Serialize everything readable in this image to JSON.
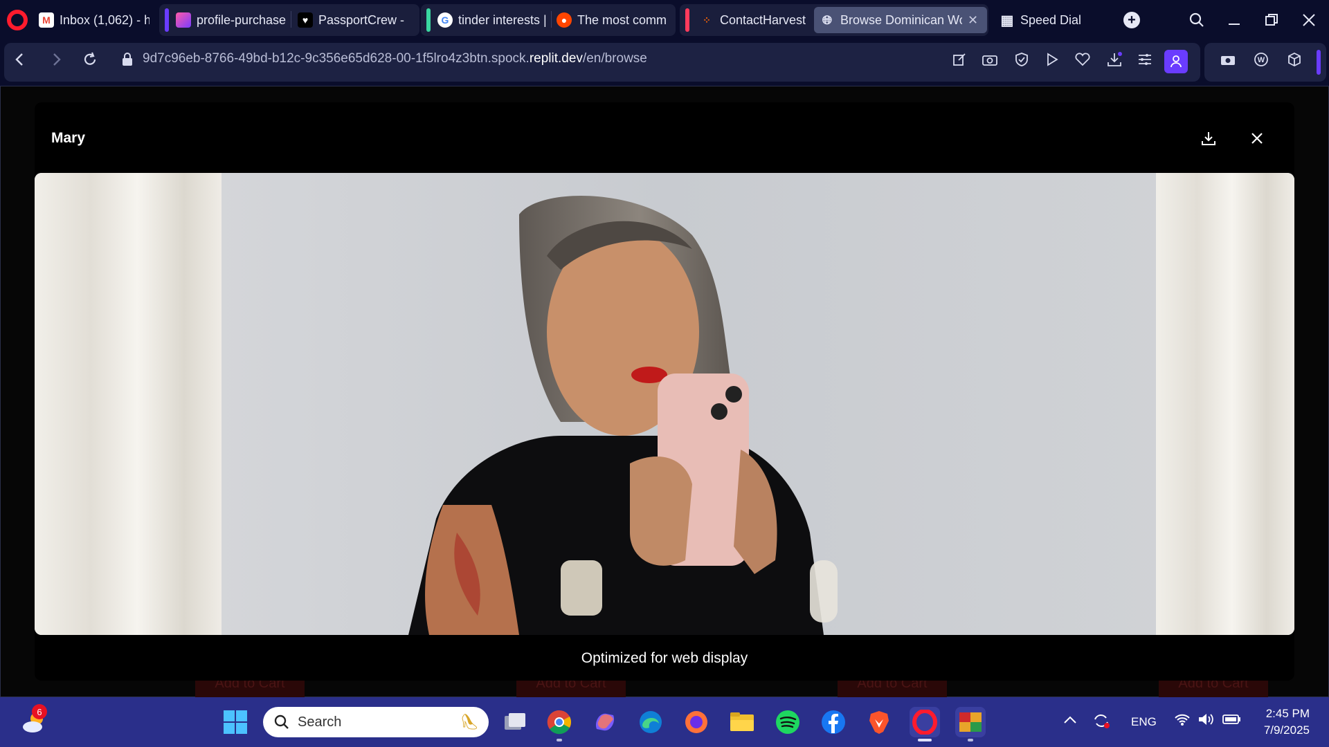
{
  "browser": {
    "tabs": [
      {
        "label": "Inbox (1,062) - h",
        "icon": "gmail-icon"
      },
      {
        "label": "profile-purchase",
        "icon": "heart-app-icon"
      },
      {
        "label": "PassportCrew - I",
        "icon": "heart-icon"
      },
      {
        "label": "tinder interests |",
        "icon": "google-icon"
      },
      {
        "label": "The most comm",
        "icon": "reddit-icon"
      },
      {
        "label": "ContactHarvest",
        "icon": "replit-icon"
      },
      {
        "label": "Browse Dominican Wo",
        "icon": "globe-icon",
        "active": true
      },
      {
        "label": "Speed Dial",
        "icon": "speed-dial-icon"
      }
    ],
    "address": {
      "prefix": "9d7c96eb-8766-49bd-b12c-9c356e65d628-00-1f5lro4z3btn.spock.",
      "host": "replit.dev",
      "path": "/en/browse"
    }
  },
  "modal": {
    "title": "Mary",
    "caption": "Optimized for web display"
  },
  "background": {
    "cart_label": "Add to Cart"
  },
  "taskbar": {
    "search_placeholder": "Search",
    "weather_badge": "6",
    "language": "ENG",
    "time": "2:45 PM",
    "date": "7/9/2025"
  },
  "colors": {
    "accent": "#6a3cff",
    "opera_red": "#ff1b2d",
    "taskbar": "#2a2f8a"
  }
}
